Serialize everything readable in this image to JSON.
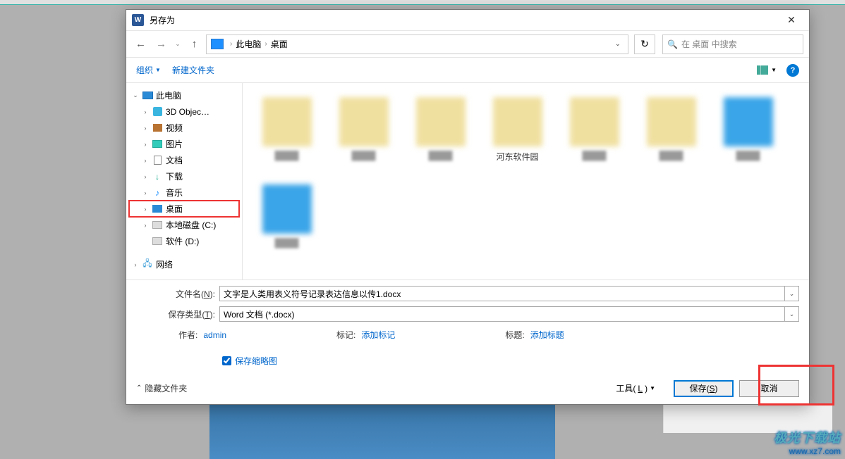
{
  "titlebar": {
    "title": "另存为"
  },
  "nav": {
    "breadcrumb": {
      "root": "此电脑",
      "folder": "桌面"
    },
    "search_placeholder": "在 桌面 中搜索"
  },
  "toolbar": {
    "organize": "组织",
    "newfolder": "新建文件夹"
  },
  "tree": {
    "thispc": "此电脑",
    "items": [
      {
        "label": "3D Objec…"
      },
      {
        "label": "视频"
      },
      {
        "label": "图片"
      },
      {
        "label": "文档"
      },
      {
        "label": "下载"
      },
      {
        "label": "音乐"
      },
      {
        "label": "桌面"
      },
      {
        "label": "本地磁盘 (C:)"
      },
      {
        "label": "软件 (D:)"
      }
    ],
    "network": "网络"
  },
  "files": {
    "item4": "河东软件园"
  },
  "form": {
    "filename_label_pre": "文件名(",
    "filename_label_key": "N",
    "filename_label_post": "):",
    "filename_value": "文字是人类用表义符号记录表达信息以传1.docx",
    "type_label_pre": "保存类型(",
    "type_label_key": "T",
    "type_label_post": "):",
    "type_value": "Word 文档 (*.docx)",
    "author_label": "作者:",
    "author_value": "admin",
    "tag_label": "标记:",
    "tag_value": "添加标记",
    "title_label": "标题:",
    "title_value": "添加标题",
    "thumb_label": "保存缩略图"
  },
  "buttons": {
    "hide": "隐藏文件夹",
    "tools_pre": "工具(",
    "tools_key": "L",
    "tools_post": ")",
    "save_pre": "保存(",
    "save_key": "S",
    "save_post": ")",
    "cancel": "取消"
  },
  "watermark": {
    "line1": "极光下载站",
    "line2": "www.xz7.com"
  }
}
